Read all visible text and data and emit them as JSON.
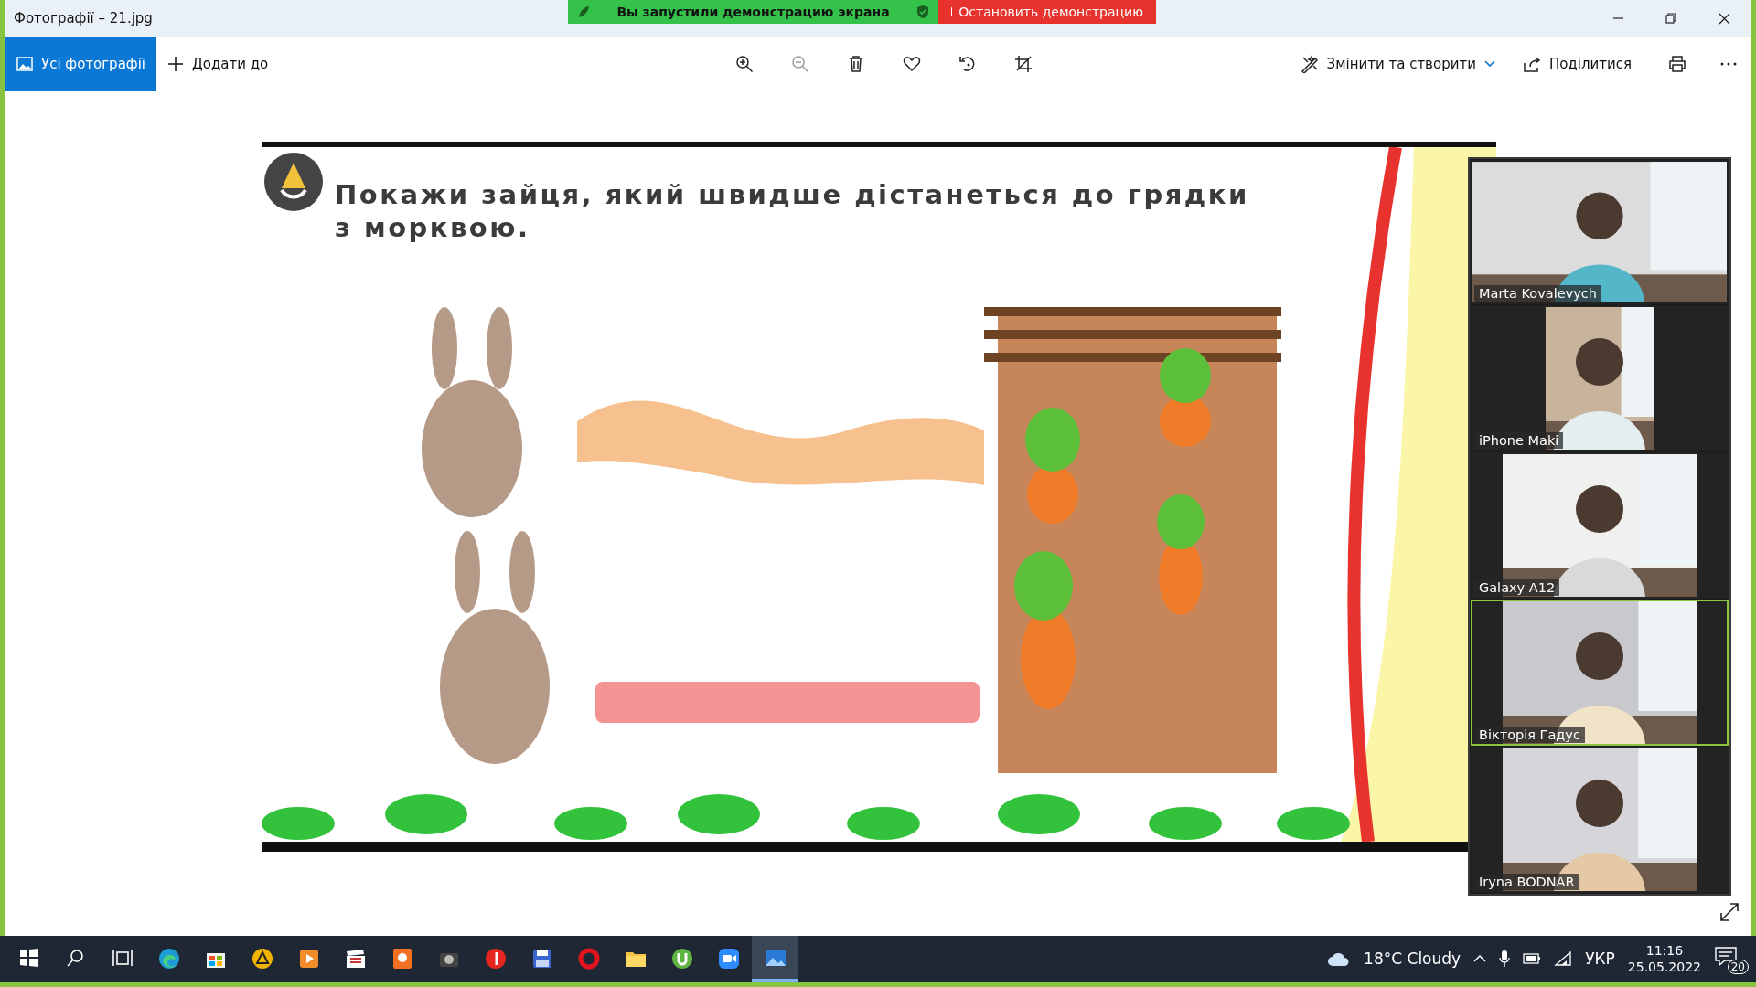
{
  "window": {
    "title": "Фотографії – 21.jpg"
  },
  "share_banner": {
    "message": "Вы запустили демонстрацию экрана",
    "stop_button": "Остановить демонстрацию"
  },
  "toolbar": {
    "left": [
      {
        "label": "Усі фотографії",
        "selected": true
      },
      {
        "label": "Додати до",
        "selected": false
      }
    ],
    "center": [
      {
        "disabled": false
      },
      {
        "disabled": true
      },
      {
        "disabled": false
      },
      {
        "disabled": false
      },
      {
        "disabled": false
      },
      {
        "disabled": false
      }
    ],
    "right": [
      {
        "label": "Змінити та створити"
      },
      {
        "label": "Поділитися"
      }
    ]
  },
  "slide": {
    "lines": [
      "Покажи зайця, який швидше дістанеться до грядки",
      "з морквою."
    ]
  },
  "participants": [
    {
      "name": "Marta Kovalevych",
      "selected": false
    },
    {
      "name": "iPhone Maki",
      "selected": false
    },
    {
      "name": "Galaxy A12",
      "selected": false
    },
    {
      "name": "Вікторія Гадус",
      "selected": true
    },
    {
      "name": "Iryna BODNAR",
      "selected": false
    }
  ],
  "taskbar": {
    "apps": [
      {
        "selected": false
      },
      {
        "selected": false
      },
      {
        "selected": false
      },
      {
        "selected": false
      },
      {
        "selected": false
      },
      {
        "selected": false
      },
      {
        "selected": false
      },
      {
        "selected": false
      },
      {
        "selected": false
      },
      {
        "selected": false
      },
      {
        "selected": false
      },
      {
        "selected": false
      },
      {
        "selected": false
      },
      {
        "selected": true
      }
    ],
    "weather": "18°C  Cloudy",
    "language": "УКР",
    "time": "11:16",
    "date": "25.05.2022",
    "notifications": "20"
  }
}
